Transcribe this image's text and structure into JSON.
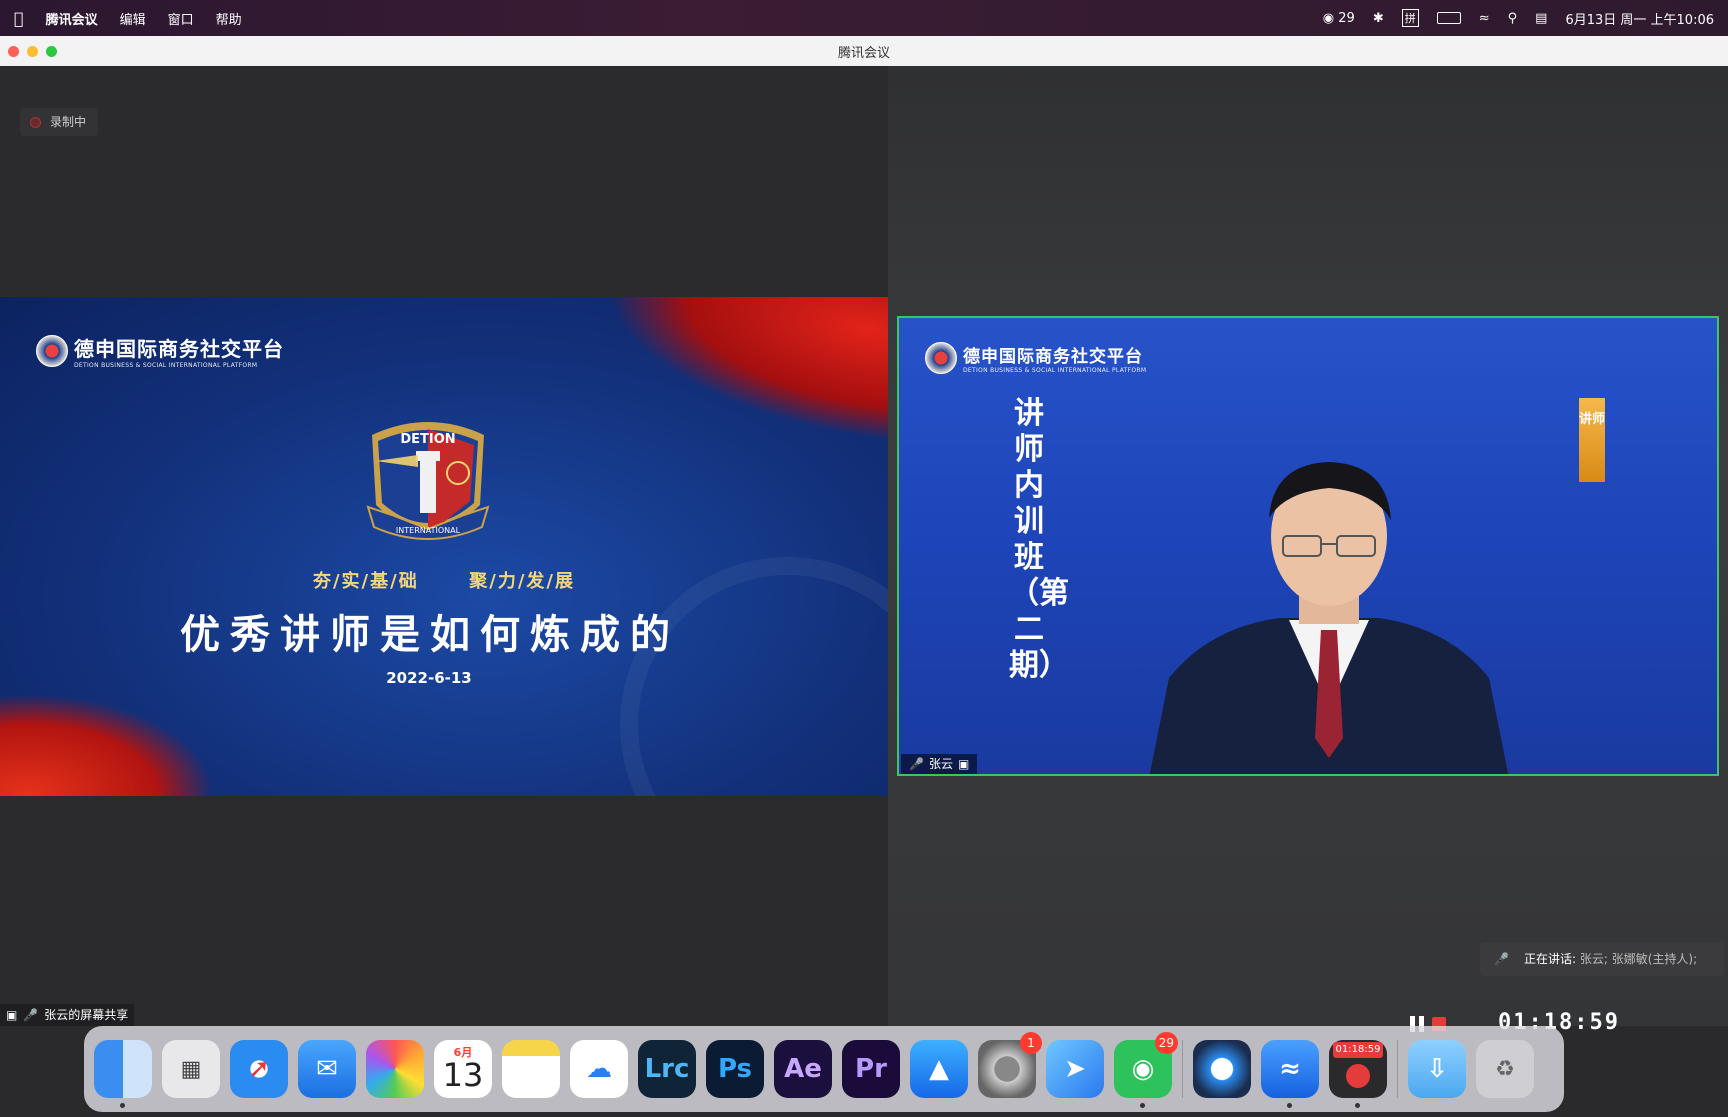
{
  "menubar": {
    "menus": [
      "腾讯会议",
      "编辑",
      "窗口",
      "帮助"
    ],
    "wechat_count": "29",
    "input_method": "拼",
    "clock": "6月13日 周一 上午10:06"
  },
  "window": {
    "title": "腾讯会议"
  },
  "recording": {
    "label": "录制中"
  },
  "slide": {
    "brand_name": "德申国际商务社交平台",
    "brand_sub": "DETION BUSINESS & SOCIAL INTERNATIONAL PLATFORM",
    "emblem_top": "DETION",
    "emblem_bottom": "INTERNATIONAL",
    "slogan_left": "夯/实/基/础",
    "slogan_right": "聚/力/发/展",
    "title": "优秀讲师是如何炼成的",
    "date": "2022-6-13"
  },
  "video": {
    "brand_name": "德申国际商务社交平台",
    "brand_sub": "DETION BUSINESS & SOCIAL INTERNATIONAL PLATFORM",
    "vertical_title": "讲师内训班（第二期）",
    "tag": "讲师",
    "participant": "张云"
  },
  "share_label": "张云的屏幕共享",
  "speaking": {
    "label": "正在讲话:",
    "who": "张云; 张娜敏(主持人);"
  },
  "recording_timer": "01:18:59",
  "dock": {
    "calendar_month": "6月",
    "calendar_day": "13",
    "settings_badge": "1",
    "wechat_badge": "29",
    "rec_time": "01:18:59",
    "apps": [
      "Lrc",
      "Ps",
      "Ae",
      "Pr"
    ]
  }
}
